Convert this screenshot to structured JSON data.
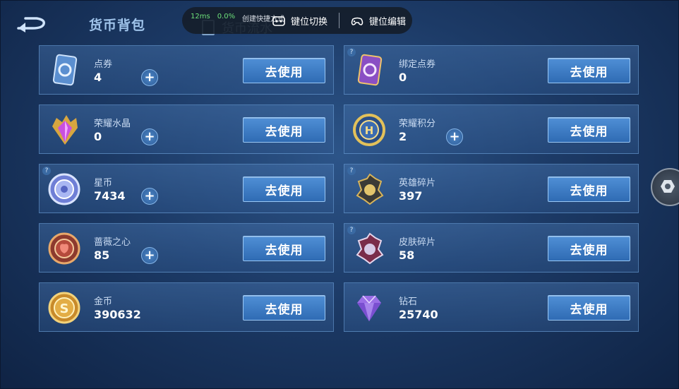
{
  "header": {
    "title": "货币背包",
    "tab2_label": "货币流水"
  },
  "overlay": {
    "latency": "12ms",
    "loss": "0.0%",
    "tip": "创建快捷方式",
    "btn1_label": "键位切换",
    "btn2_label": "键位编辑"
  },
  "use_label": "去使用",
  "cards": [
    {
      "name": "点券",
      "value": "4",
      "icon": "ticket-icon",
      "plus": true,
      "help": false
    },
    {
      "name": "绑定点券",
      "value": "0",
      "icon": "bound-ticket-icon",
      "plus": false,
      "help": true
    },
    {
      "name": "荣耀水晶",
      "value": "0",
      "icon": "crystal-icon",
      "plus": true,
      "help": false
    },
    {
      "name": "荣耀积分",
      "value": "2",
      "icon": "glory-points-icon",
      "plus": true,
      "help": false
    },
    {
      "name": "星币",
      "value": "7434",
      "icon": "star-coin-icon",
      "plus": true,
      "help": true
    },
    {
      "name": "英雄碎片",
      "value": "397",
      "icon": "hero-fragment-icon",
      "plus": false,
      "help": true
    },
    {
      "name": "蔷薇之心",
      "value": "85",
      "icon": "rose-heart-icon",
      "plus": true,
      "help": false
    },
    {
      "name": "皮肤碎片",
      "value": "58",
      "icon": "skin-fragment-icon",
      "plus": false,
      "help": true
    },
    {
      "name": "金币",
      "value": "390632",
      "icon": "gold-coin-icon",
      "plus": false,
      "help": false
    },
    {
      "name": "钻石",
      "value": "25740",
      "icon": "diamond-icon",
      "plus": false,
      "help": false
    }
  ]
}
